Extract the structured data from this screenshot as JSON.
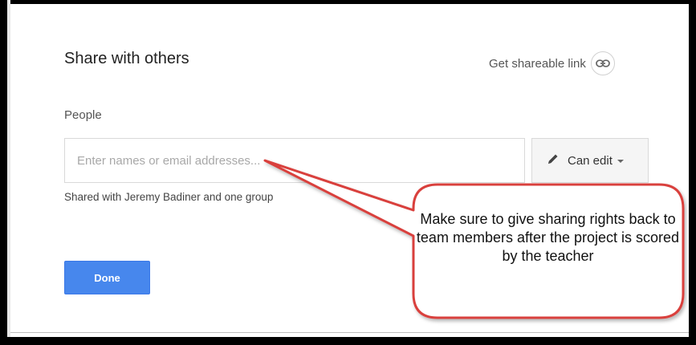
{
  "dialog": {
    "title": "Share with others",
    "shareable_link_label": "Get shareable link",
    "people_label": "People",
    "input_placeholder": "Enter names or email addresses...",
    "permission_label": "Can edit",
    "shared_with_text": "Shared with Jeremy Badiner and one group",
    "done_label": "Done"
  },
  "callout": {
    "text": "Make sure to give sharing rights back to team members after the project is scored by the teacher",
    "color": "#d9413c"
  },
  "colors": {
    "done_button": "#4787ed",
    "text_primary": "#222222",
    "text_secondary": "#555555"
  },
  "icons": {
    "link": "link-icon",
    "pencil": "pencil-icon",
    "caret": "chevron-down-icon"
  }
}
